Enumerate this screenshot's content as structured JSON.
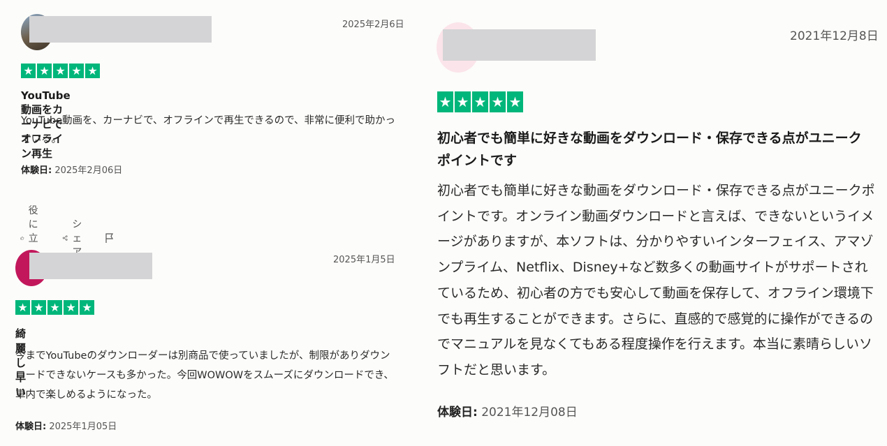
{
  "reviews": [
    {
      "date": "2025年2月6日",
      "rating": 5,
      "title": "YouTube動画をカーナビでオフライン再生",
      "body": "YouTube動画を、カーナビで、オフラインで再生できるので、非常に便利で助かっている。",
      "experience_label": "体験日:",
      "experience_date": "2025年2月06日",
      "actions": {
        "helpful": "役に立った",
        "share": "シェア"
      }
    },
    {
      "date": "2025年1月5日",
      "rating": 5,
      "title": "綺麗し早い",
      "body": "今までYouTubeのダウンローダーは別商品で使っていましたが、制限がありダウンロードできないケースも多かった。今回WOWOWをスムーズにダウンロードでき、車内で楽しめるようになった。",
      "experience_label": "体験日:",
      "experience_date": "2025年1月05日"
    },
    {
      "date": "2021年12月8日",
      "rating": 5,
      "title": "初心者でも簡単に好きな動画をダウンロード・保存できる点がユニークポイントです",
      "body": "初心者でも簡単に好きな動画をダウンロード・保存できる点がユニークポイントです。オンライン動画ダウンロードと言えば、できないというイメージがありますが、本ソフトは、分かりやすいインターフェイス、アマゾンプライム、Netflix、Disney+など数多くの動画サイトがサポートされているため、初心者の方でも安心して動画を保存して、オフライン環境下でも再生することができます。さらに、直感的で感覚的に操作ができるのでマニュアルを見なくてもある程度操作を行えます。本当に素晴らしいソフトだと思います。",
      "experience_label": "体験日:",
      "experience_date": "2021年12月08日"
    }
  ],
  "colors": {
    "star_green": "#00b67a",
    "redaction": "#d4d4d6"
  },
  "icons": [
    "thumbs-up-icon",
    "share-icon",
    "flag-icon",
    "star-icon"
  ]
}
